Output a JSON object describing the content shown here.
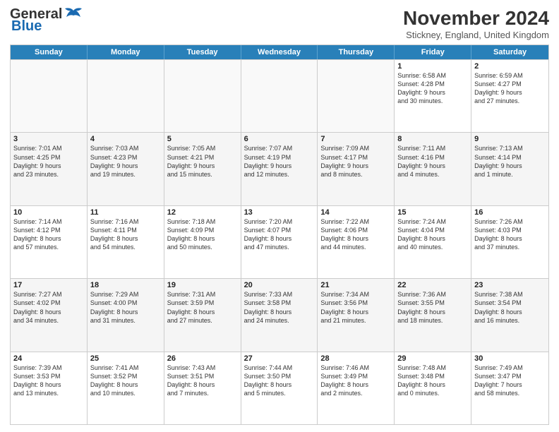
{
  "header": {
    "logo_line1": "General",
    "logo_line2": "Blue",
    "month": "November 2024",
    "location": "Stickney, England, United Kingdom"
  },
  "days_of_week": [
    "Sunday",
    "Monday",
    "Tuesday",
    "Wednesday",
    "Thursday",
    "Friday",
    "Saturday"
  ],
  "rows": [
    [
      {
        "day": "",
        "info": "",
        "empty": true
      },
      {
        "day": "",
        "info": "",
        "empty": true
      },
      {
        "day": "",
        "info": "",
        "empty": true
      },
      {
        "day": "",
        "info": "",
        "empty": true
      },
      {
        "day": "",
        "info": "",
        "empty": true
      },
      {
        "day": "1",
        "info": "Sunrise: 6:58 AM\nSunset: 4:28 PM\nDaylight: 9 hours\nand 30 minutes.",
        "empty": false
      },
      {
        "day": "2",
        "info": "Sunrise: 6:59 AM\nSunset: 4:27 PM\nDaylight: 9 hours\nand 27 minutes.",
        "empty": false
      }
    ],
    [
      {
        "day": "3",
        "info": "Sunrise: 7:01 AM\nSunset: 4:25 PM\nDaylight: 9 hours\nand 23 minutes.",
        "empty": false
      },
      {
        "day": "4",
        "info": "Sunrise: 7:03 AM\nSunset: 4:23 PM\nDaylight: 9 hours\nand 19 minutes.",
        "empty": false
      },
      {
        "day": "5",
        "info": "Sunrise: 7:05 AM\nSunset: 4:21 PM\nDaylight: 9 hours\nand 15 minutes.",
        "empty": false
      },
      {
        "day": "6",
        "info": "Sunrise: 7:07 AM\nSunset: 4:19 PM\nDaylight: 9 hours\nand 12 minutes.",
        "empty": false
      },
      {
        "day": "7",
        "info": "Sunrise: 7:09 AM\nSunset: 4:17 PM\nDaylight: 9 hours\nand 8 minutes.",
        "empty": false
      },
      {
        "day": "8",
        "info": "Sunrise: 7:11 AM\nSunset: 4:16 PM\nDaylight: 9 hours\nand 4 minutes.",
        "empty": false
      },
      {
        "day": "9",
        "info": "Sunrise: 7:13 AM\nSunset: 4:14 PM\nDaylight: 9 hours\nand 1 minute.",
        "empty": false
      }
    ],
    [
      {
        "day": "10",
        "info": "Sunrise: 7:14 AM\nSunset: 4:12 PM\nDaylight: 8 hours\nand 57 minutes.",
        "empty": false
      },
      {
        "day": "11",
        "info": "Sunrise: 7:16 AM\nSunset: 4:11 PM\nDaylight: 8 hours\nand 54 minutes.",
        "empty": false
      },
      {
        "day": "12",
        "info": "Sunrise: 7:18 AM\nSunset: 4:09 PM\nDaylight: 8 hours\nand 50 minutes.",
        "empty": false
      },
      {
        "day": "13",
        "info": "Sunrise: 7:20 AM\nSunset: 4:07 PM\nDaylight: 8 hours\nand 47 minutes.",
        "empty": false
      },
      {
        "day": "14",
        "info": "Sunrise: 7:22 AM\nSunset: 4:06 PM\nDaylight: 8 hours\nand 44 minutes.",
        "empty": false
      },
      {
        "day": "15",
        "info": "Sunrise: 7:24 AM\nSunset: 4:04 PM\nDaylight: 8 hours\nand 40 minutes.",
        "empty": false
      },
      {
        "day": "16",
        "info": "Sunrise: 7:26 AM\nSunset: 4:03 PM\nDaylight: 8 hours\nand 37 minutes.",
        "empty": false
      }
    ],
    [
      {
        "day": "17",
        "info": "Sunrise: 7:27 AM\nSunset: 4:02 PM\nDaylight: 8 hours\nand 34 minutes.",
        "empty": false
      },
      {
        "day": "18",
        "info": "Sunrise: 7:29 AM\nSunset: 4:00 PM\nDaylight: 8 hours\nand 31 minutes.",
        "empty": false
      },
      {
        "day": "19",
        "info": "Sunrise: 7:31 AM\nSunset: 3:59 PM\nDaylight: 8 hours\nand 27 minutes.",
        "empty": false
      },
      {
        "day": "20",
        "info": "Sunrise: 7:33 AM\nSunset: 3:58 PM\nDaylight: 8 hours\nand 24 minutes.",
        "empty": false
      },
      {
        "day": "21",
        "info": "Sunrise: 7:34 AM\nSunset: 3:56 PM\nDaylight: 8 hours\nand 21 minutes.",
        "empty": false
      },
      {
        "day": "22",
        "info": "Sunrise: 7:36 AM\nSunset: 3:55 PM\nDaylight: 8 hours\nand 18 minutes.",
        "empty": false
      },
      {
        "day": "23",
        "info": "Sunrise: 7:38 AM\nSunset: 3:54 PM\nDaylight: 8 hours\nand 16 minutes.",
        "empty": false
      }
    ],
    [
      {
        "day": "24",
        "info": "Sunrise: 7:39 AM\nSunset: 3:53 PM\nDaylight: 8 hours\nand 13 minutes.",
        "empty": false
      },
      {
        "day": "25",
        "info": "Sunrise: 7:41 AM\nSunset: 3:52 PM\nDaylight: 8 hours\nand 10 minutes.",
        "empty": false
      },
      {
        "day": "26",
        "info": "Sunrise: 7:43 AM\nSunset: 3:51 PM\nDaylight: 8 hours\nand 7 minutes.",
        "empty": false
      },
      {
        "day": "27",
        "info": "Sunrise: 7:44 AM\nSunset: 3:50 PM\nDaylight: 8 hours\nand 5 minutes.",
        "empty": false
      },
      {
        "day": "28",
        "info": "Sunrise: 7:46 AM\nSunset: 3:49 PM\nDaylight: 8 hours\nand 2 minutes.",
        "empty": false
      },
      {
        "day": "29",
        "info": "Sunrise: 7:48 AM\nSunset: 3:48 PM\nDaylight: 8 hours\nand 0 minutes.",
        "empty": false
      },
      {
        "day": "30",
        "info": "Sunrise: 7:49 AM\nSunset: 3:47 PM\nDaylight: 7 hours\nand 58 minutes.",
        "empty": false
      }
    ]
  ]
}
